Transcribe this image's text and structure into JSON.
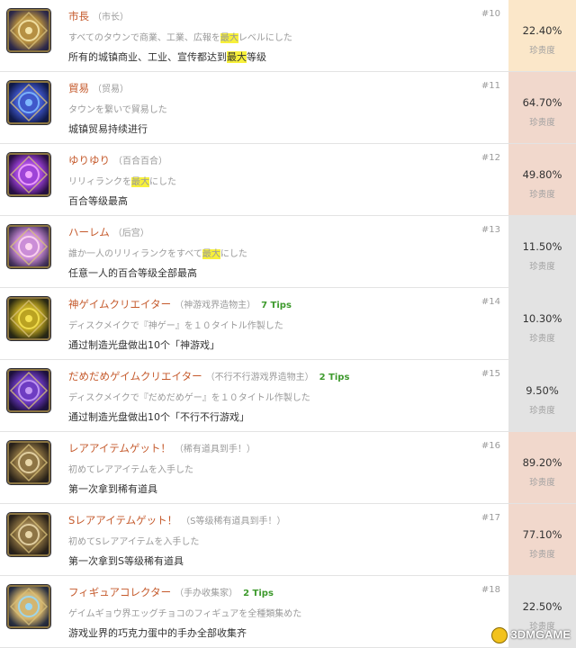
{
  "achievements": [
    {
      "num": "#10",
      "title_jp": "市長",
      "title_cn": "（市长）",
      "tips": "",
      "desc_jp": [
        "すべてのタウンで商業、工業、広報を",
        "最大",
        "レベルにした"
      ],
      "desc_cn": [
        "所有的城镇商业、工业、宣传都达到",
        "最大",
        "等级"
      ],
      "rate": "22.40%",
      "rate_label": "珍贵度",
      "rate_color": "#fbe7c9",
      "icon": "max-badge-icon"
    },
    {
      "num": "#11",
      "title_jp": "貿易",
      "title_cn": "（贸易）",
      "tips": "",
      "desc_jp": [
        "タウンを繋いで貿易した",
        "",
        ""
      ],
      "desc_cn": [
        "城镇贸易持续进行",
        "",
        ""
      ],
      "rate": "64.70%",
      "rate_label": "珍贵度",
      "rate_color": "#f1d8cc",
      "icon": "trade-badge-icon"
    },
    {
      "num": "#12",
      "title_jp": "ゆりゆり",
      "title_cn": "（百合百合）",
      "tips": "",
      "desc_jp": [
        "リリィランクを",
        "最大",
        "にした"
      ],
      "desc_cn": [
        "百合等级最高",
        "",
        ""
      ],
      "rate": "49.80%",
      "rate_label": "珍贵度",
      "rate_color": "#f1d8cc",
      "icon": "lily-badge-icon"
    },
    {
      "num": "#13",
      "title_jp": "ハーレム",
      "title_cn": "（后宫）",
      "tips": "",
      "desc_jp": [
        "誰か一人のリリィランクをすべて",
        "最大",
        "にした"
      ],
      "desc_cn": [
        "任意一人的百合等级全部最高",
        "",
        ""
      ],
      "rate": "11.50%",
      "rate_label": "珍贵度",
      "rate_color": "#e3e3e3",
      "icon": "harem-badge-icon"
    },
    {
      "num": "#14",
      "title_jp": "神ゲイムクリエイター",
      "title_cn": "（神游戏界造物主）",
      "tips": "7 Tips",
      "desc_jp": [
        "ディスクメイクで『神ゲー』を１０タイトル作製した",
        "",
        ""
      ],
      "desc_cn": [
        "通过制造光盘做出10个「神游戏」",
        "",
        ""
      ],
      "rate": "10.30%",
      "rate_label": "珍贵度",
      "rate_color": "#e3e3e3",
      "icon": "gold-disc-icon"
    },
    {
      "num": "#15",
      "title_jp": "だめだめゲイムクリエイター",
      "title_cn": "（不行不行游戏界造物主）",
      "tips": "2 Tips",
      "desc_jp": [
        "ディスクメイクで『だめだめゲー』を１０タイトル作製した",
        "",
        ""
      ],
      "desc_cn": [
        "通过制造光盘做出10个「不行不行游戏」",
        "",
        ""
      ],
      "rate": "9.50%",
      "rate_label": "珍贵度",
      "rate_color": "#e3e3e3",
      "icon": "purple-disc-icon"
    },
    {
      "num": "#16",
      "title_jp": "レアアイテムゲット！",
      "title_cn": "（稀有道具到手！）",
      "tips": "",
      "desc_jp": [
        "初めてレアアイテムを入手した",
        "",
        ""
      ],
      "desc_cn": [
        "第一次拿到稀有道具",
        "",
        ""
      ],
      "rate": "89.20%",
      "rate_label": "珍贵度",
      "rate_color": "#f1d8cc",
      "icon": "rare-item-icon"
    },
    {
      "num": "#17",
      "title_jp": "Sレアアイテムゲット！",
      "title_cn": "（S等级稀有道具到手！）",
      "tips": "",
      "desc_jp": [
        "初めてSレアアイテムを入手した",
        "",
        ""
      ],
      "desc_cn": [
        "第一次拿到S等级稀有道具",
        "",
        ""
      ],
      "rate": "77.10%",
      "rate_label": "珍贵度",
      "rate_color": "#f1d8cc",
      "icon": "s-rare-item-icon"
    },
    {
      "num": "#18",
      "title_jp": "フィギュアコレクター",
      "title_cn": "（手办收集家）",
      "tips": "2 Tips",
      "desc_jp": [
        "ゲイムギョウ界エッグチョコのフィギュアを全種類集めた",
        "",
        ""
      ],
      "desc_cn": [
        "游戏业界的巧克力蛋中的手办全部收集齐",
        "",
        ""
      ],
      "rate": "22.50%",
      "rate_label": "珍贵度",
      "rate_color": "#e3e3e3",
      "icon": "figure-badge-icon"
    }
  ],
  "watermark": "3DMGAME"
}
